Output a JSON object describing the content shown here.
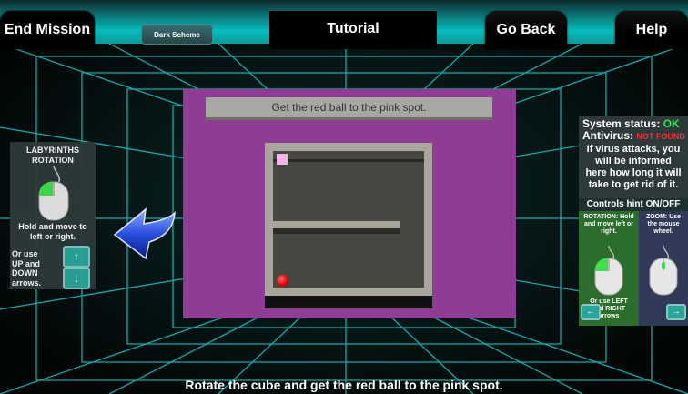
{
  "topbar": {
    "end_mission": "End Mission",
    "dark_scheme": "Dark Scheme",
    "tutorial": "Tutorial",
    "go_back": "Go Back",
    "help": "Help"
  },
  "left_panel": {
    "title_line1": "LABYRINTHS",
    "title_line2": "ROTATION",
    "hold_line1": "Hold and move to",
    "hold_line2": "left or right.",
    "or_use_lines": [
      "Or use",
      "UP and",
      "DOWN",
      "arrows."
    ],
    "up_arrow_glyph": "↑",
    "down_arrow_glyph": "↓"
  },
  "right_panel": {
    "system_status_label": "System status:",
    "system_status_value": "OK",
    "antivirus_label": "Antivirus:",
    "antivirus_value": "NOT FOUND",
    "info_lines": [
      "If virus attacks, you",
      "will be informed",
      "here how long it will",
      "take to get rid of it."
    ],
    "controls_hint": "Controls hint ON/OFF",
    "rotation_lines": [
      "ROTATION: Hold",
      "and move left or",
      "right."
    ],
    "zoom_lines": [
      "ZOOM: Use",
      "the mouse",
      "wheel."
    ],
    "or_use_lines": [
      "Or use LEFT",
      "and RIGHT",
      "arrows"
    ],
    "left_arrow_glyph": "←",
    "right_arrow_glyph": "→"
  },
  "cube": {
    "banner": "Get the red ball to the pink spot."
  },
  "bottom_message": "Rotate the cube and get the red ball to the pink spot.",
  "colors": {
    "accent": "#06bcbc",
    "cube": "#8f3d94",
    "status_ok": "#2ee84a",
    "antivirus_alert": "#ff2a2a",
    "pink_spot": "#f6b2ec",
    "red_ball": "#e00000"
  }
}
